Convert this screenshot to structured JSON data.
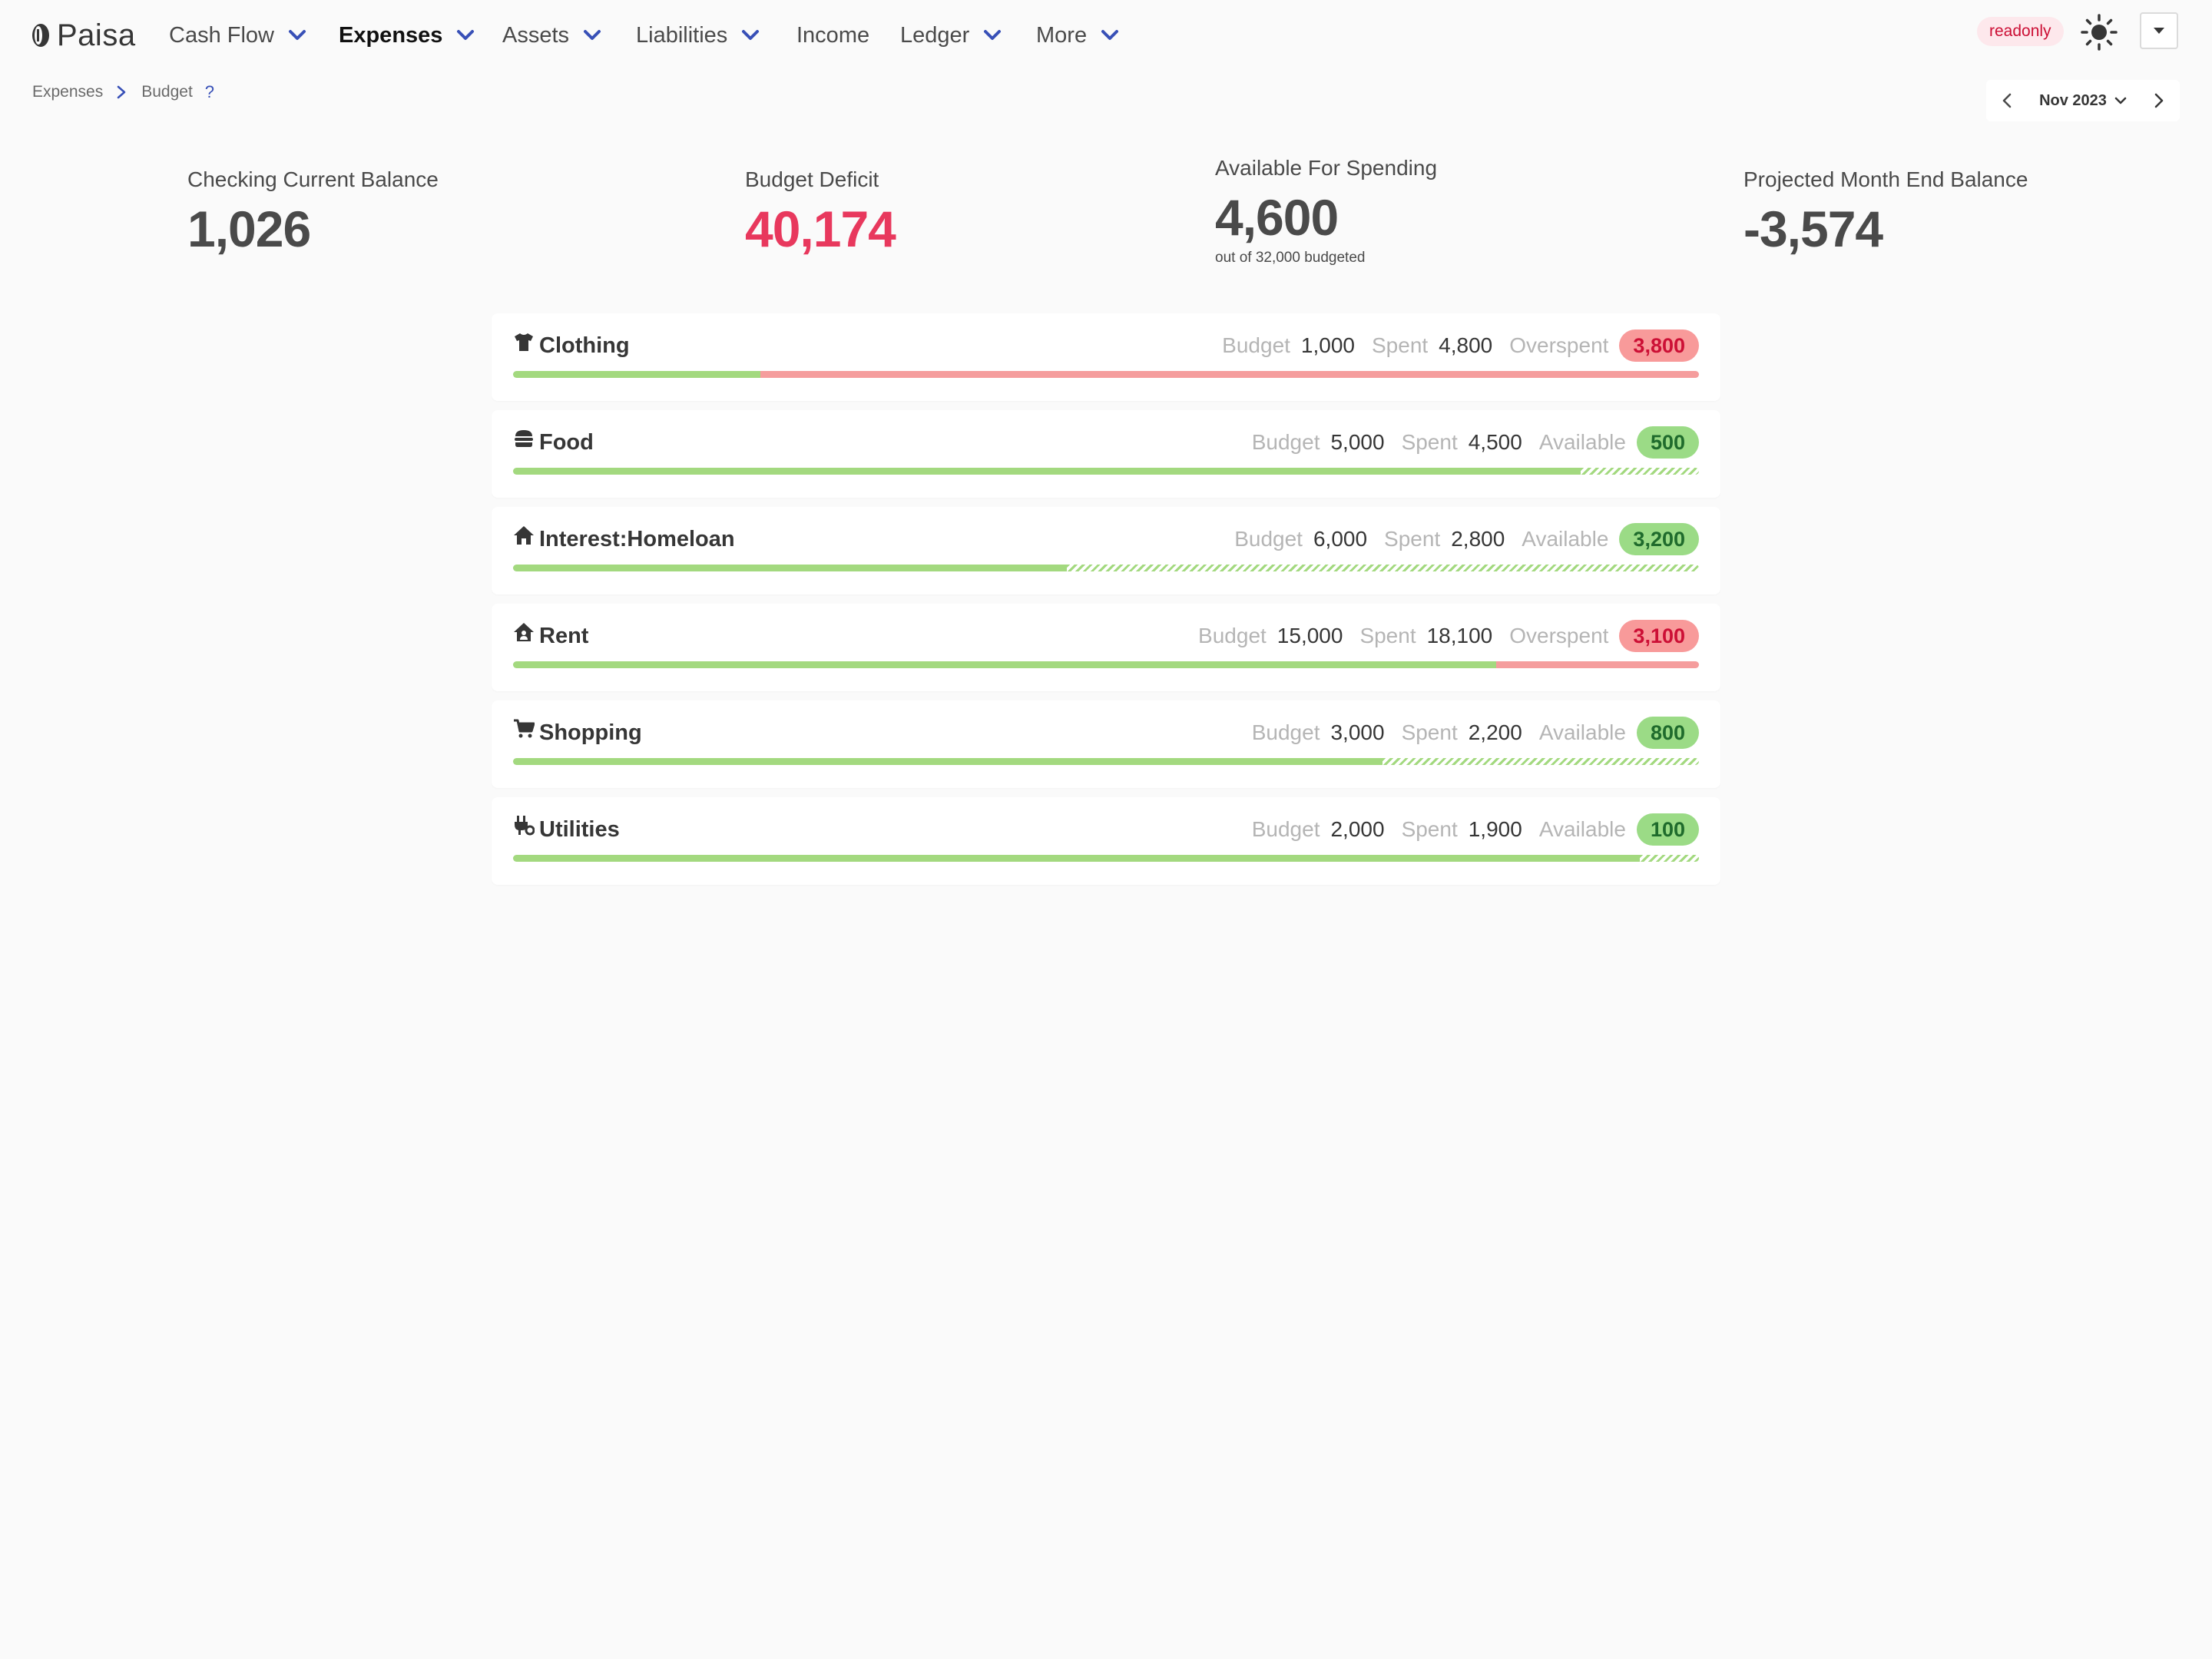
{
  "app": {
    "name": "Paisa"
  },
  "nav": {
    "items": [
      {
        "label": "Cash Flow",
        "dropdown": true,
        "active": false
      },
      {
        "label": "Expenses",
        "dropdown": true,
        "active": true
      },
      {
        "label": "Assets",
        "dropdown": true,
        "active": false
      },
      {
        "label": "Liabilities",
        "dropdown": true,
        "active": false
      },
      {
        "label": "Income",
        "dropdown": false,
        "active": false
      },
      {
        "label": "Ledger",
        "dropdown": true,
        "active": false
      },
      {
        "label": "More",
        "dropdown": true,
        "active": false
      }
    ],
    "readonly_label": "readonly",
    "theme_icon": "sun-icon"
  },
  "breadcrumb": {
    "parent": "Expenses",
    "current": "Budget",
    "help": "?"
  },
  "month_picker": {
    "label": "Nov 2023"
  },
  "stats": {
    "checking": {
      "label": "Checking Current Balance",
      "value": "1,026"
    },
    "deficit": {
      "label": "Budget Deficit",
      "value": "40,174"
    },
    "available": {
      "label": "Available For Spending",
      "value": "4,600",
      "sub": "out of 32,000 budgeted"
    },
    "projected": {
      "label": "Projected Month End Balance",
      "value": "-3,574"
    }
  },
  "labels": {
    "budget": "Budget",
    "spent": "Spent"
  },
  "budgets": [
    {
      "name": "Clothing",
      "icon": "tshirt-icon",
      "budget": "1,000",
      "spent": "4,800",
      "status": "Overspent",
      "amount": "3,800",
      "over": true,
      "spent_fraction": 0.2083
    },
    {
      "name": "Food",
      "icon": "burger-icon",
      "budget": "5,000",
      "spent": "4,500",
      "status": "Available",
      "amount": "500",
      "over": false,
      "spent_fraction": 0.9
    },
    {
      "name": "Interest:Homeloan",
      "icon": "home-icon",
      "budget": "6,000",
      "spent": "2,800",
      "status": "Available",
      "amount": "3,200",
      "over": false,
      "spent_fraction": 0.4667
    },
    {
      "name": "Rent",
      "icon": "house-user-icon",
      "budget": "15,000",
      "spent": "18,100",
      "status": "Overspent",
      "amount": "3,100",
      "over": true,
      "spent_fraction": 0.8287
    },
    {
      "name": "Shopping",
      "icon": "cart-icon",
      "budget": "3,000",
      "spent": "2,200",
      "status": "Available",
      "amount": "800",
      "over": false,
      "spent_fraction": 0.7333
    },
    {
      "name": "Utilities",
      "icon": "plug-icon",
      "budget": "2,000",
      "spent": "1,900",
      "status": "Available",
      "amount": "100",
      "over": false,
      "spent_fraction": 0.95
    }
  ]
}
